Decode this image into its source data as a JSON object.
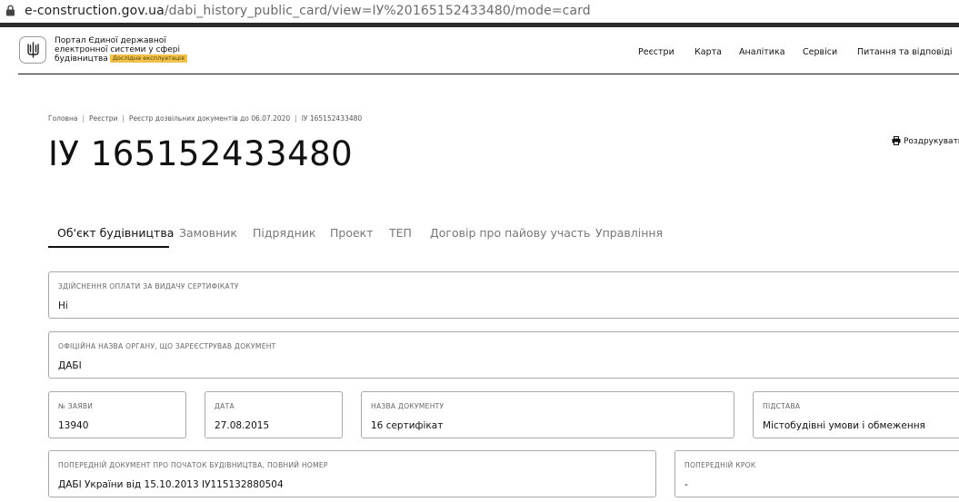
{
  "browser": {
    "url_domain": "e-construction.gov.ua",
    "url_path": "/dabi_history_public_card/view=ІУ%20165152433480/mode=card"
  },
  "header": {
    "brand_lines": [
      "Портал Єдиної державної",
      "електронної системи у сфері",
      "будівництва"
    ],
    "badge": "Дослідна експлуатація",
    "nav": [
      "Реєстри",
      "Карта",
      "Аналітика",
      "Сервіси",
      "Питання та відповіді"
    ]
  },
  "breadcrumb": [
    "Головна",
    "Реєстри",
    "Реєстр дозвільних документів до 06.07.2020",
    "ІУ 165152433480"
  ],
  "page": {
    "title": "ІУ 165152433480",
    "print_label": "Роздрукувати"
  },
  "tabs": [
    "Об'єкт будівництва",
    "Замовник",
    "Підрядник",
    "Проект",
    "ТЕП",
    "Договір про пайову участь",
    "Управління"
  ],
  "fields": {
    "payment": {
      "label": "ЗДІЙСНЕННЯ ОПЛАТИ ЗА ВИДАЧУ СЕРТИФІКАТУ",
      "value": "Ні"
    },
    "authority": {
      "label": "ОФІЦІЙНА НАЗВА ОРГАНУ, ЩО ЗАРЕЄСТРУВАВ ДОКУМЕНТ",
      "value": "ДАБІ"
    },
    "app_number": {
      "label": "№ ЗАЯВИ",
      "value": "13940"
    },
    "date": {
      "label": "ДАТА",
      "value": "27.08.2015"
    },
    "doc_name": {
      "label": "НАЗВА ДОКУМЕНТУ",
      "value": "16 сертифікат"
    },
    "basis": {
      "label": "ПІДСТАВА",
      "value": "Містобудівні умови і обмеження"
    },
    "prev_doc": {
      "label": "ПОПЕРЕДНІЙ ДОКУМЕНТ ПРО ПОЧАТОК БУДІВНИЦТВА, ПОВНИЙ НОМЕР",
      "value": "ДАБІ України від 15.10.2013 ІУ115132880504"
    },
    "prev_step": {
      "label": "ПОПЕРЕДНІЙ КРОК",
      "value": "-"
    }
  },
  "icons": {
    "lock": "lock-icon",
    "emblem": "trident-emblem-icon",
    "print": "printer-icon"
  },
  "colors": {
    "badge": "#f0c24b",
    "text": "#111111",
    "muted": "#777777",
    "border": "#a9a9a9"
  }
}
